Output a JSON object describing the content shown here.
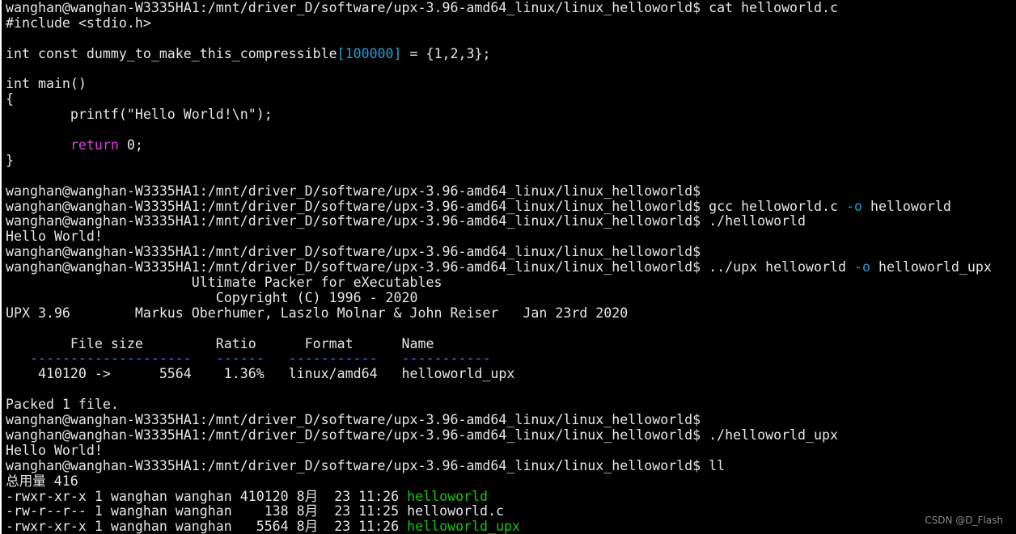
{
  "terminal": {
    "lines": [
      [
        {
          "t": "wanghan@wanghan-W3335HA1:/mnt/driver_D/software/upx-3.96-amd64_linux/linux_helloworld$ cat helloworld.c"
        }
      ],
      [
        {
          "t": "#include <stdio.h>"
        }
      ],
      [
        {
          "t": ""
        }
      ],
      [
        {
          "t": "int const dummy_to_make_this_compressible"
        },
        {
          "t": "[100000]",
          "c": "blue"
        },
        {
          "t": " = {1,2,3};"
        }
      ],
      [
        {
          "t": ""
        }
      ],
      [
        {
          "t": "int main()"
        }
      ],
      [
        {
          "t": "{"
        }
      ],
      [
        {
          "t": "        printf(\"Hello World!\\n\");"
        }
      ],
      [
        {
          "t": ""
        }
      ],
      [
        {
          "t": "        "
        },
        {
          "t": "return",
          "c": "purple"
        },
        {
          "t": " 0;"
        }
      ],
      [
        {
          "t": "}"
        }
      ],
      [
        {
          "t": ""
        }
      ],
      [
        {
          "t": "wanghan@wanghan-W3335HA1:/mnt/driver_D/software/upx-3.96-amd64_linux/linux_helloworld$"
        }
      ],
      [
        {
          "t": "wanghan@wanghan-W3335HA1:/mnt/driver_D/software/upx-3.96-amd64_linux/linux_helloworld$ gcc helloworld.c "
        },
        {
          "t": "-o",
          "c": "blue"
        },
        {
          "t": " helloworld"
        }
      ],
      [
        {
          "t": "wanghan@wanghan-W3335HA1:/mnt/driver_D/software/upx-3.96-amd64_linux/linux_helloworld$ ./helloworld"
        }
      ],
      [
        {
          "t": "Hello World!"
        }
      ],
      [
        {
          "t": "wanghan@wanghan-W3335HA1:/mnt/driver_D/software/upx-3.96-amd64_linux/linux_helloworld$"
        }
      ],
      [
        {
          "t": "wanghan@wanghan-W3335HA1:/mnt/driver_D/software/upx-3.96-amd64_linux/linux_helloworld$ ../upx helloworld "
        },
        {
          "t": "-o",
          "c": "blue"
        },
        {
          "t": " helloworld_upx"
        }
      ],
      [
        {
          "t": "                       Ultimate Packer for eXecutables"
        }
      ],
      [
        {
          "t": "                          Copyright (C) 1996 - 2020"
        }
      ],
      [
        {
          "t": "UPX 3.96        Markus Oberhumer, Laszlo Molnar & John Reiser   Jan 23rd 2020"
        }
      ],
      [
        {
          "t": ""
        }
      ],
      [
        {
          "t": "        File size         Ratio      Format      Name"
        }
      ],
      [
        {
          "t": "   "
        },
        {
          "t": "--------------------   ------   -----------   -----------",
          "c": "dash"
        }
      ],
      [
        {
          "t": "    410120 ->      5564    1.36%   linux/amd64   helloworld_upx"
        }
      ],
      [
        {
          "t": ""
        }
      ],
      [
        {
          "t": "Packed 1 file."
        }
      ],
      [
        {
          "t": "wanghan@wanghan-W3335HA1:/mnt/driver_D/software/upx-3.96-amd64_linux/linux_helloworld$"
        }
      ],
      [
        {
          "t": "wanghan@wanghan-W3335HA1:/mnt/driver_D/software/upx-3.96-amd64_linux/linux_helloworld$ ./helloworld_upx"
        }
      ],
      [
        {
          "t": "Hello World!"
        }
      ],
      [
        {
          "t": "wanghan@wanghan-W3335HA1:/mnt/driver_D/software/upx-3.96-amd64_linux/linux_helloworld$ ll"
        }
      ],
      [
        {
          "t": "总用量 416"
        }
      ],
      [
        {
          "t": "-rwxr-xr-x 1 wanghan wanghan 410120 8月  23 11:26 "
        },
        {
          "t": "helloworld",
          "c": "green"
        }
      ],
      [
        {
          "t": "-rw-r--r-- 1 wanghan wanghan    138 8月  23 11:25 helloworld.c"
        }
      ],
      [
        {
          "t": "-rwxr-xr-x 1 wanghan wanghan   5564 8月  23 11:26 "
        },
        {
          "t": "helloworld_upx",
          "c": "green"
        }
      ]
    ]
  },
  "watermark": "CSDN @D_Flash",
  "colors": {
    "background": "#000000",
    "foreground": "#e6e6e6",
    "blue": "#1f9fd6",
    "purple": "#d63fd6",
    "green": "#16c60c",
    "dash": "#3b78ff"
  }
}
